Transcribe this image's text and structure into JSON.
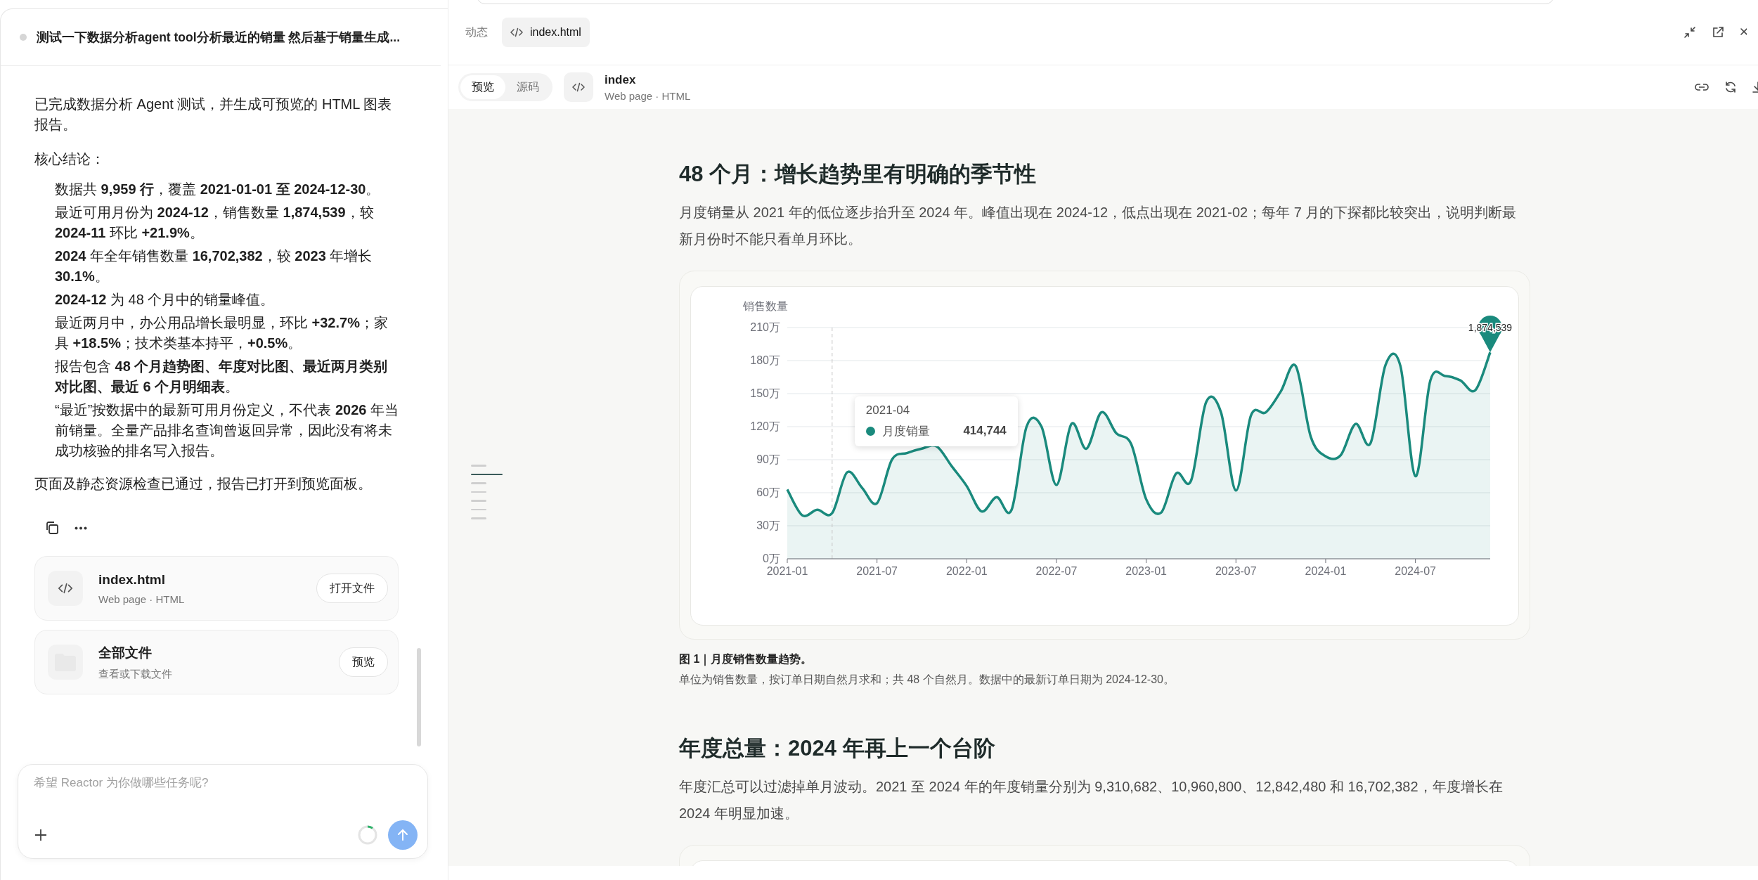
{
  "conversation": {
    "title": "测试一下数据分析agent tool分析最近的销量 然后基于销量生成...",
    "intro": "已完成数据分析 Agent 测试，并生成可预览的 HTML 图表报告。",
    "summary_label": "核心结论：",
    "findings": [
      "数据共 **9,959 行**，覆盖 **2021-01-01 至 2024-12-30**。",
      "最近可用月份为 **2024-12**，销售数量 **1,874,539**，较 **2024-11** 环比 **+21.9%**。",
      "**2024** 年全年销售数量 **16,702,382**，较 **2023** 年增长 **30.1%**。",
      "**2024-12** 为 48 个月中的销量峰值。",
      "最近两月中，办公用品增长最明显，环比 **+32.7%**；家具 **+18.5%**；技术类基本持平，**+0.5%**。",
      "报告包含 **48 个月趋势图、年度对比图、最近两月类别对比图、最近 6 个月明细表**。",
      "“最近”按数据中的最新可用月份定义，不代表 **2026** 年当前销量。全量产品排名查询曾返回异常，因此没有将未成功核验的排名写入报告。"
    ],
    "closing": "页面及静态资源检查已通过，报告已打开到预览面板。",
    "files": [
      {
        "kind": "code",
        "name": "index.html",
        "subtitle": "Web page · HTML",
        "action": "打开文件"
      },
      {
        "kind": "folder",
        "name": "全部文件",
        "subtitle": "查看或下载文件",
        "action": "预览"
      }
    ]
  },
  "composer": {
    "placeholder": "希望 Reactor 为你做哪些任务呢?"
  },
  "preview": {
    "tabs": [
      {
        "kind": "text",
        "label": "动态",
        "selected": false
      },
      {
        "kind": "code",
        "label": "index.html",
        "selected": true
      }
    ],
    "mode_toggle": [
      {
        "label": "预览",
        "selected": true
      },
      {
        "label": "源码",
        "selected": false
      }
    ],
    "document": {
      "title": "index",
      "subtitle": "Web page · HTML"
    },
    "toc_markers": [
      {
        "selected": false
      },
      {
        "selected": true
      },
      {
        "selected": false
      },
      {
        "selected": false
      },
      {
        "selected": false
      },
      {
        "selected": false
      },
      {
        "selected": false
      }
    ],
    "sections": [
      {
        "title": "48 个月：增长趋势里有明确的季节性",
        "body": "月度销量从 2021 年的低位逐步抬升至 2024 年。峰值出现在 2024-12，低点出现在 2021-02；每年 7 月的下探都比较突出，说明判断最新月份时不能只看单月环比。",
        "chart_data": {
          "type": "area",
          "ylabel": "销售数量",
          "categories": [
            "2021-01",
            null,
            null,
            null,
            null,
            null,
            "2021-07",
            null,
            null,
            null,
            null,
            null,
            "2022-01",
            null,
            null,
            null,
            null,
            null,
            "2022-07",
            null,
            null,
            null,
            null,
            null,
            "2023-01",
            null,
            null,
            null,
            null,
            null,
            "2023-07",
            null,
            null,
            null,
            null,
            null,
            "2024-01",
            null,
            null,
            null,
            null,
            null,
            "2024-07",
            null,
            null,
            null,
            null,
            null
          ],
          "series": [
            {
              "name": "月度销量",
              "color": "#1a8a7d",
              "values": [
                63,
                39.5,
                44.5,
                41.5,
                78.5,
                null,
                50.5,
                90,
                96,
                100,
                102,
                null,
                66,
                43,
                56,
                44.5,
                120,
                120,
                67,
                122.5,
                100,
                133,
                114,
                104,
                54,
                42,
                77.5,
                71,
                142,
                133,
                62,
                130,
                133,
                152,
                175,
                111,
                93,
                94,
                122.5,
                105,
                176,
                175,
                75,
                162,
                166,
                162,
                153,
                187.5
              ]
            }
          ],
          "ylim": [
            0,
            210
          ],
          "grid": true,
          "yticks": [
            {
              "value": 0,
              "label": "0万"
            },
            {
              "value": 30,
              "label": "30万"
            },
            {
              "value": 60,
              "label": "60万"
            },
            {
              "value": 90,
              "label": "90万"
            },
            {
              "value": 120,
              "label": "120万"
            },
            {
              "value": 150,
              "label": "150万"
            },
            {
              "value": 180,
              "label": "180万"
            },
            {
              "value": 210,
              "label": "210万"
            }
          ]
        },
        "tooltip": {
          "title": "2021-04",
          "value": "414,744"
        },
        "peak_label": "1,874,539",
        "caption_title": "图 1｜月度销售数量趋势。",
        "caption_note": "单位为销售数量，按订单日期自然月求和；共 48 个自然月。数据中的最新订单日期为 2024-12-30。"
      },
      {
        "title": "年度总量：2024 年再上一个台阶",
        "body": "年度汇总可以过滤掉单月波动。2021 至 2024 年的年度销量分别为 9,310,682、10,960,800、12,842,480 和 16,702,382，年度增长在 2024 年明显加速。"
      }
    ]
  }
}
